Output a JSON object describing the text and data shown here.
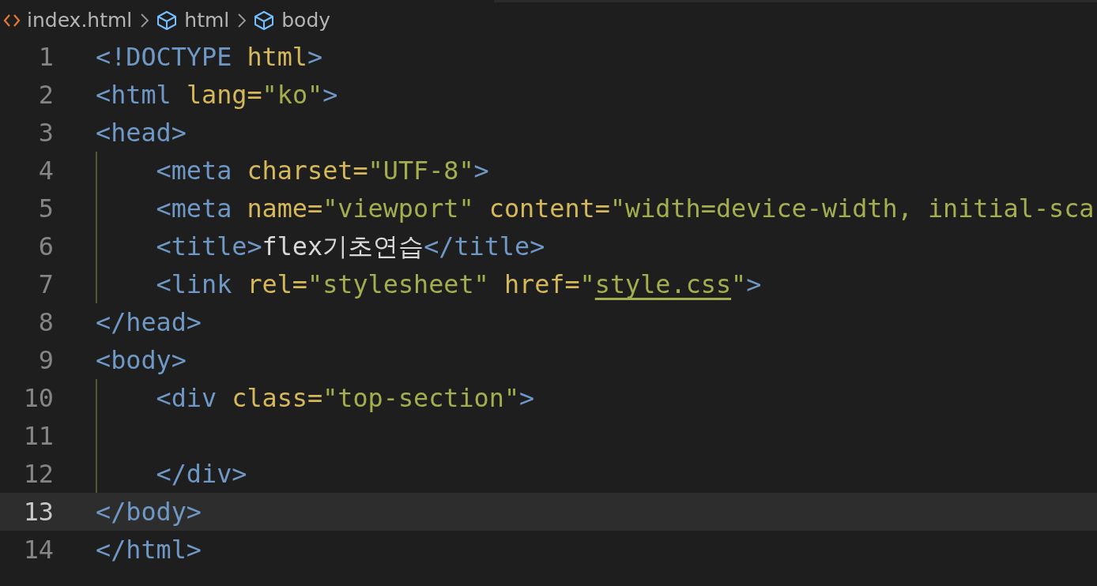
{
  "breadcrumb": [
    {
      "label": "index.html",
      "kind": "file"
    },
    {
      "label": "html",
      "kind": "element"
    },
    {
      "label": "body",
      "kind": "element"
    }
  ],
  "lines": [
    {
      "number": "1",
      "current": false,
      "tokens": [
        {
          "text": "<!DOCTYPE ",
          "kind": "tag"
        },
        {
          "text": "html",
          "kind": "attr"
        },
        {
          "text": ">",
          "kind": "tag"
        }
      ]
    },
    {
      "number": "2",
      "current": false,
      "tokens": [
        {
          "text": "<html ",
          "kind": "tag"
        },
        {
          "text": "lang=",
          "kind": "attr"
        },
        {
          "text": "\"ko\"",
          "kind": "string"
        },
        {
          "text": ">",
          "kind": "tag"
        }
      ]
    },
    {
      "number": "3",
      "current": false,
      "tokens": [
        {
          "text": "<head>",
          "kind": "tag"
        }
      ]
    },
    {
      "number": "4",
      "current": false,
      "tokens": [
        {
          "text": "    <meta ",
          "kind": "tag"
        },
        {
          "text": "charset=",
          "kind": "attr"
        },
        {
          "text": "\"UTF-8\"",
          "kind": "string"
        },
        {
          "text": ">",
          "kind": "tag"
        }
      ]
    },
    {
      "number": "5",
      "current": false,
      "tokens": [
        {
          "text": "    <meta ",
          "kind": "tag"
        },
        {
          "text": "name=",
          "kind": "attr"
        },
        {
          "text": "\"viewport\" ",
          "kind": "string"
        },
        {
          "text": "content=",
          "kind": "attr"
        },
        {
          "text": "\"width=device-width, initial-sca",
          "kind": "string"
        }
      ]
    },
    {
      "number": "6",
      "current": false,
      "tokens": [
        {
          "text": "    <title>",
          "kind": "tag"
        },
        {
          "text": "flex기초연습",
          "kind": "text"
        },
        {
          "text": "</title>",
          "kind": "tag"
        }
      ]
    },
    {
      "number": "7",
      "current": false,
      "tokens": [
        {
          "text": "    <link ",
          "kind": "tag"
        },
        {
          "text": "rel=",
          "kind": "attr"
        },
        {
          "text": "\"stylesheet\" ",
          "kind": "string"
        },
        {
          "text": "href=",
          "kind": "attr"
        },
        {
          "text": "\"",
          "kind": "string"
        },
        {
          "text": "style.css",
          "kind": "link"
        },
        {
          "text": "\"",
          "kind": "string"
        },
        {
          "text": ">",
          "kind": "tag"
        }
      ]
    },
    {
      "number": "8",
      "current": false,
      "tokens": [
        {
          "text": "</head>",
          "kind": "tag"
        }
      ]
    },
    {
      "number": "9",
      "current": false,
      "tokens": [
        {
          "text": "<body>",
          "kind": "tag"
        }
      ]
    },
    {
      "number": "10",
      "current": false,
      "tokens": [
        {
          "text": "    <div ",
          "kind": "tag"
        },
        {
          "text": "class=",
          "kind": "attr"
        },
        {
          "text": "\"top-section\"",
          "kind": "string"
        },
        {
          "text": ">",
          "kind": "tag"
        }
      ]
    },
    {
      "number": "11",
      "current": false
    },
    {
      "number": "12",
      "current": false,
      "tokens": [
        {
          "text": "    </div>",
          "kind": "tag"
        }
      ]
    },
    {
      "number": "13",
      "current": true,
      "tokens": [
        {
          "text": "</body>",
          "kind": "tag"
        }
      ]
    },
    {
      "number": "14",
      "current": false,
      "tokens": [
        {
          "text": "</html>",
          "kind": "tag"
        }
      ]
    }
  ]
}
